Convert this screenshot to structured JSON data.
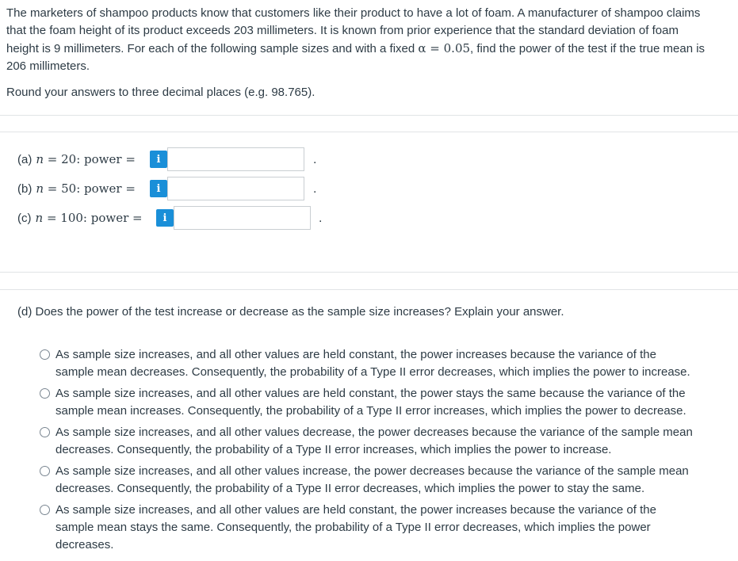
{
  "question": {
    "intro_line1": "The marketers of shampoo products know that customers like their product to have a lot of foam. A manufacturer of shampoo claims",
    "intro_line2": "that the foam height of its product exceeds 203 millimeters. It is known from prior experience that the standard deviation of foam",
    "intro_line3a": "height is 9 millimeters. For each of the following sample sizes and with a fixed ",
    "intro_alpha": "α = 0.05",
    "intro_line3b": ", find the power of the test if the true mean is",
    "intro_line4": "206 millimeters.",
    "rounding": "Round your answers to three decimal places (e.g. 98.765)."
  },
  "parts": [
    {
      "label": "(a)",
      "n": "20",
      "value": ""
    },
    {
      "label": "(b)",
      "n": "50",
      "value": ""
    },
    {
      "label": "(c)",
      "n": "100",
      "value": ""
    }
  ],
  "power_word": "power",
  "info_glyph": "i",
  "period": ".",
  "part_d": {
    "question": "(d) Does the power of the test increase or decrease as the sample size increases? Explain your answer.",
    "options": [
      {
        "line1": "As sample size increases, and all other values are held constant, the power increases because the variance of the",
        "line2": "sample mean decreases. Consequently, the probability of a Type II error decreases, which implies the power to increase.",
        "line3": ""
      },
      {
        "line1": "As sample size increases, and all other values are held constant, the power stays the same because the variance of the",
        "line2": "sample mean increases. Consequently, the probability of a Type II error increases, which implies the power to decrease.",
        "line3": ""
      },
      {
        "line1": "As sample size increases, and all other values decrease, the power decreases because the variance of the sample mean",
        "line2": "decreases. Consequently, the probability of a Type II error increases, which implies the power to increase.",
        "line3": ""
      },
      {
        "line1": "As sample size increases, and all other values increase, the power decreases because the variance of the sample mean",
        "line2": "decreases. Consequently, the probability of a Type II error decreases, which implies the power to stay the same.",
        "line3": ""
      },
      {
        "line1": "As sample size increases, and all other values are held constant, the power increases because the variance of the",
        "line2": "sample mean stays the same. Consequently, the probability of a Type II error decreases, which implies the power",
        "line3": "decreases."
      }
    ]
  },
  "colors": {
    "accent": "#1a8fd8",
    "text": "#2d3b45",
    "divider": "#e1e4e6"
  }
}
